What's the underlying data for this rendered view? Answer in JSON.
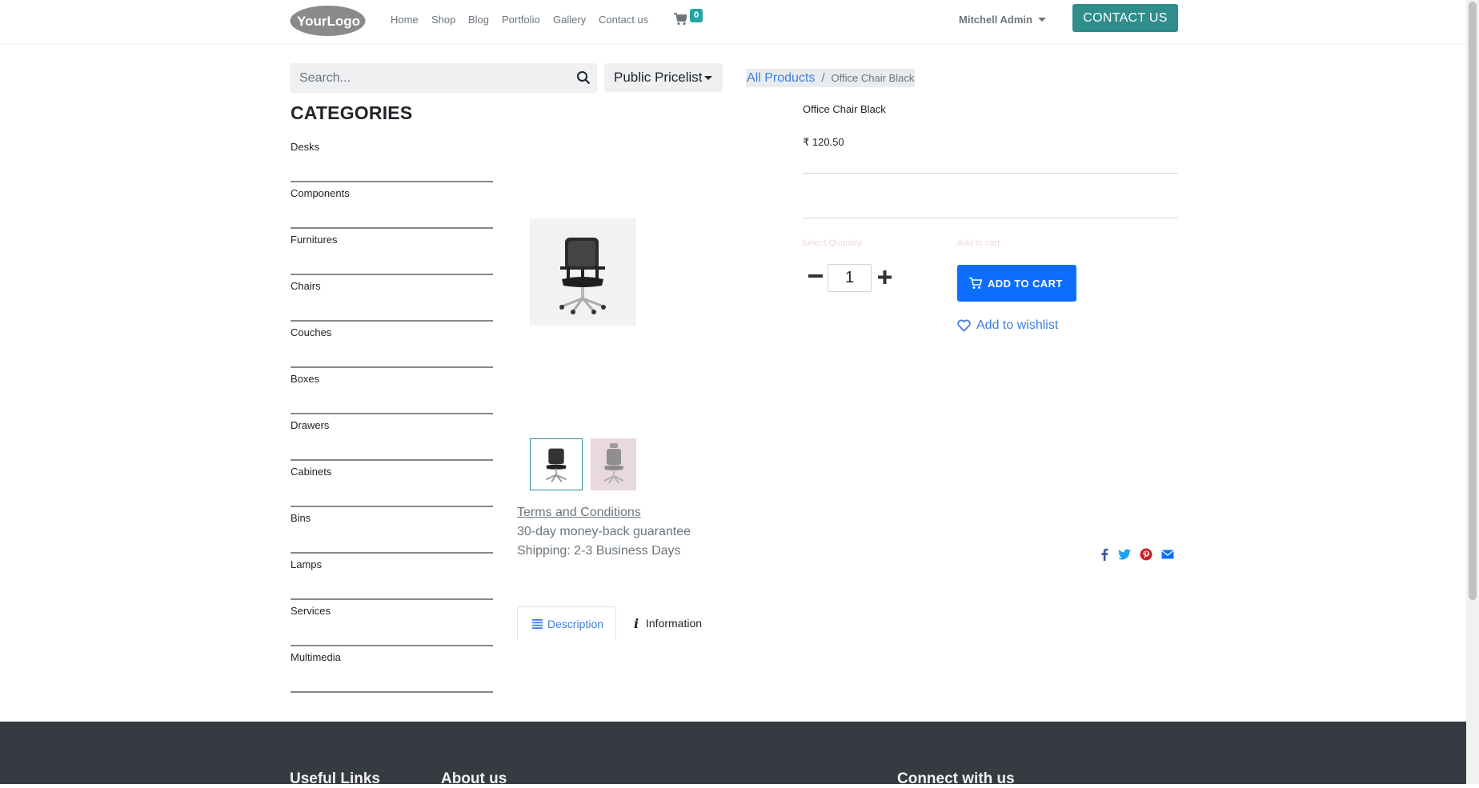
{
  "brand": {
    "logo_text": "YourLogo"
  },
  "nav": {
    "items": [
      "Home",
      "Shop",
      "Blog",
      "Portfolio",
      "Gallery",
      "Contact us"
    ],
    "cart_count": "0"
  },
  "user": {
    "name": "Mitchell Admin"
  },
  "header": {
    "contact_button": "CONTACT US"
  },
  "search": {
    "placeholder": "Search...",
    "pricelist": "Public Pricelist"
  },
  "breadcrumb": {
    "parent": "All Products",
    "separator": "/",
    "current": "Office Chair Black"
  },
  "categories": {
    "title": "CATEGORIES",
    "items": [
      "Desks",
      "Components",
      "Furnitures",
      "Chairs",
      "Couches",
      "Boxes",
      "Drawers",
      "Cabinets",
      "Bins",
      "Lamps",
      "Services",
      "Multimedia"
    ]
  },
  "product": {
    "name": "Office Chair Black",
    "price": "₹ 120.50",
    "quantity_label": "Select Quantity",
    "cart_label": "Add to cart",
    "quantity": "1",
    "add_to_cart": "ADD TO CART",
    "wishlist": "Add to wishlist",
    "terms": "Terms and Conditions",
    "guarantee": "30-day money-back guarantee",
    "shipping": "Shipping: 2-3 Business Days"
  },
  "tabs": [
    "Description",
    "Information"
  ],
  "share": [
    "facebook-icon",
    "twitter-icon",
    "pinterest-icon",
    "email-icon"
  ],
  "footer": {
    "headings": [
      "Useful Links",
      "About us",
      "Connect with us"
    ]
  },
  "colors": {
    "accent": "#2f8d8c",
    "primary": "#0d6efd",
    "link": "#3f7ed8",
    "footer_bg": "#363b42"
  }
}
